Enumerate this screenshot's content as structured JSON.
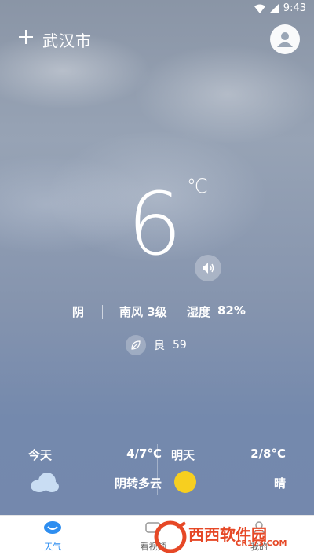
{
  "status_bar": {
    "time": "9:43"
  },
  "header": {
    "city": "武汉市"
  },
  "current": {
    "temperature": "6",
    "unit": "℃",
    "condition": "阴",
    "wind": "南风 3级",
    "humidity_label": "湿度",
    "humidity_value": "82%",
    "aqi_label": "良",
    "aqi_value": "59"
  },
  "forecast": [
    {
      "day": "今天",
      "range": "4/7°C",
      "desc": "阴转多云",
      "icon": "cloud-icon"
    },
    {
      "day": "明天",
      "range": "2/8°C",
      "desc": "晴",
      "icon": "sun-icon"
    }
  ],
  "tabs": [
    {
      "label": "天气",
      "active": true
    },
    {
      "label": "看视频",
      "active": false
    },
    {
      "label": "我的",
      "active": false
    }
  ],
  "watermark": {
    "brand": "西西软件园",
    "url": "CR173.COM"
  },
  "colors": {
    "accent": "#2e8ef0",
    "sun": "#f7cf1f",
    "cloud": "#c9ddf3"
  }
}
